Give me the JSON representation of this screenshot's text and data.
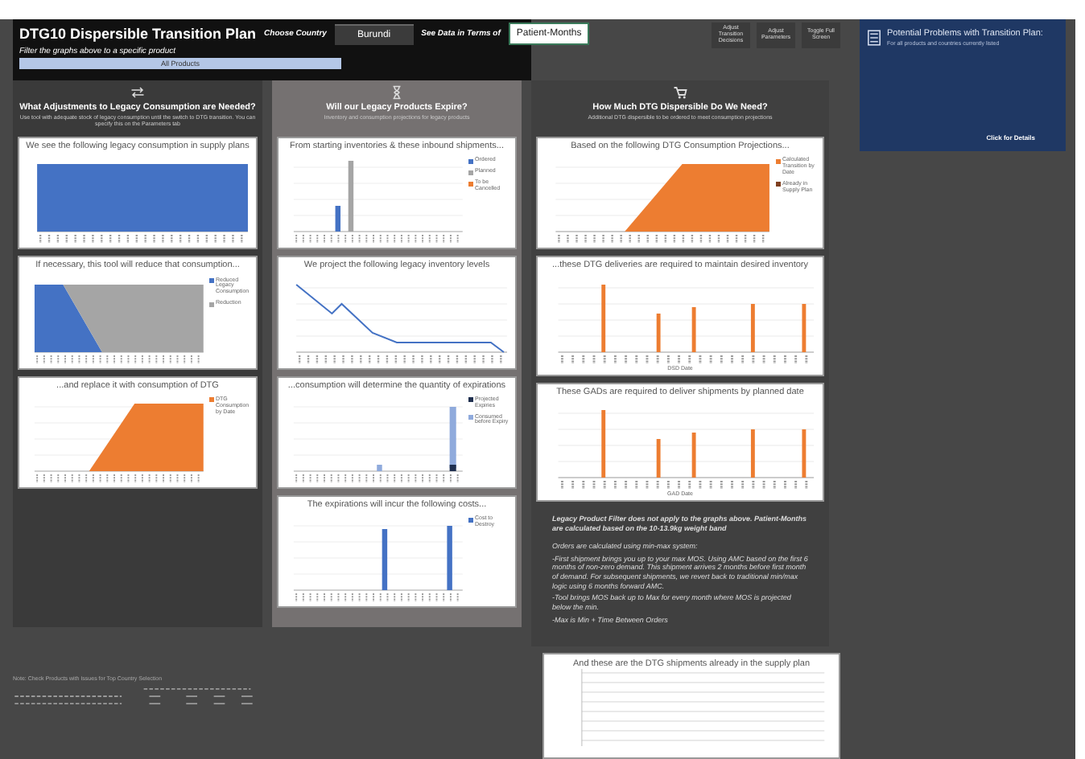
{
  "header": {
    "title": "DTG10 Dispersible Transition Plan",
    "country_label": "Choose Country",
    "country": "Burundi",
    "units_label": "See Data in Terms of",
    "units": "Patient-Months",
    "filter_label": "Filter the graphs above to a specific product",
    "filter_value": "All Products",
    "buttons": [
      "Adjust Transition Decisions",
      "Adjust Parameters",
      "Toggle Full Screen"
    ]
  },
  "problems_panel": {
    "title": "Potential Problems with Transition Plan:",
    "subtitle": "For all products and countries currently listed",
    "link": "Click for Details"
  },
  "columns": [
    {
      "title": "What Adjustments to Legacy Consumption are Needed?",
      "subtitle": "Use tool with adequate stock of legacy consumption until the switch to DTG transition. You can specify this on the Parameters tab",
      "charts": [
        {
          "title": "We see the following legacy consumption in supply plans",
          "kind": "area-full"
        },
        {
          "title": "If necessary, this tool will reduce that consumption...",
          "kind": "area-reduce",
          "legend": [
            {
              "label": "Reduced Legacy Consumption",
              "color": "#4472c4"
            },
            {
              "label": "Reduction",
              "color": "#a5a5a5"
            }
          ]
        },
        {
          "title": "...and replace it with consumption of DTG",
          "kind": "area-ramp",
          "legend": [
            {
              "label": "DTG Consumption by Date",
              "color": "#ed7d31"
            }
          ]
        }
      ]
    },
    {
      "title": "Will our Legacy Products Expire?",
      "subtitle": "Inventory and consumption projections for legacy products",
      "charts": [
        {
          "title": "From starting inventories & these inbound shipments...",
          "kind": "bars-inbound",
          "legend": [
            {
              "label": "Ordered",
              "color": "#4472c4"
            },
            {
              "label": "Planned",
              "color": "#a5a5a5"
            },
            {
              "label": "To be Cancelled",
              "color": "#ed7d31"
            }
          ]
        },
        {
          "title": "We project the following legacy inventory levels",
          "kind": "line-decline"
        },
        {
          "title": "...consumption will determine the quantity of expirations",
          "kind": "bars-expiry",
          "legend": [
            {
              "label": "Projected Expiries",
              "color": "#1f2f4f"
            },
            {
              "label": "Consumed before Expiry",
              "color": "#8faadc"
            }
          ]
        },
        {
          "title": "The expirations will incur the following costs...",
          "kind": "bars-cost",
          "legend": [
            {
              "label": "Cost to Destroy",
              "color": "#4472c4"
            }
          ]
        }
      ]
    },
    {
      "title": "How Much DTG Dispersible Do We Need?",
      "subtitle": "Additional DTG dispersible to be ordered to meet consumption projections",
      "charts": [
        {
          "title": "Based on the following DTG Consumption Projections...",
          "kind": "area-ramp",
          "legend": [
            {
              "label": "Calculated Transition by Date",
              "color": "#ed7d31"
            },
            {
              "label": "Already in Supply Plan",
              "color": "#7f3f1f"
            }
          ]
        },
        {
          "title": "...these DTG deliveries are required to maintain desired inventory",
          "kind": "bars-orange",
          "xlabel": "DSD Date"
        },
        {
          "title": "These GADs are required to deliver shipments by planned date",
          "kind": "bars-orange",
          "xlabel": "GAD Date"
        }
      ]
    }
  ],
  "notes": [
    "Legacy Product Filter does not apply to the graphs above. **Patient-Months** are calculated based on the 10-13.9kg weight band",
    "Orders are calculated using min-max system:",
    "-First shipment brings you up to your max MOS. Using AMC based on the first 6 months of non-zero demand. This shipment arrives 2 months before first month of demand. For subsequent shipments, we revert back to traditional min/max logic using 6 months forward AMC.",
    "-Tool brings MOS back up to Max for every month where MOS is projected below the min.",
    "-Max is Min + Time Between Orders"
  ],
  "supply_chart": {
    "title": "And these are the DTG shipments already in the supply plan"
  },
  "issues_note": "Note: Check Products with Issues for Top Country Selection"
}
